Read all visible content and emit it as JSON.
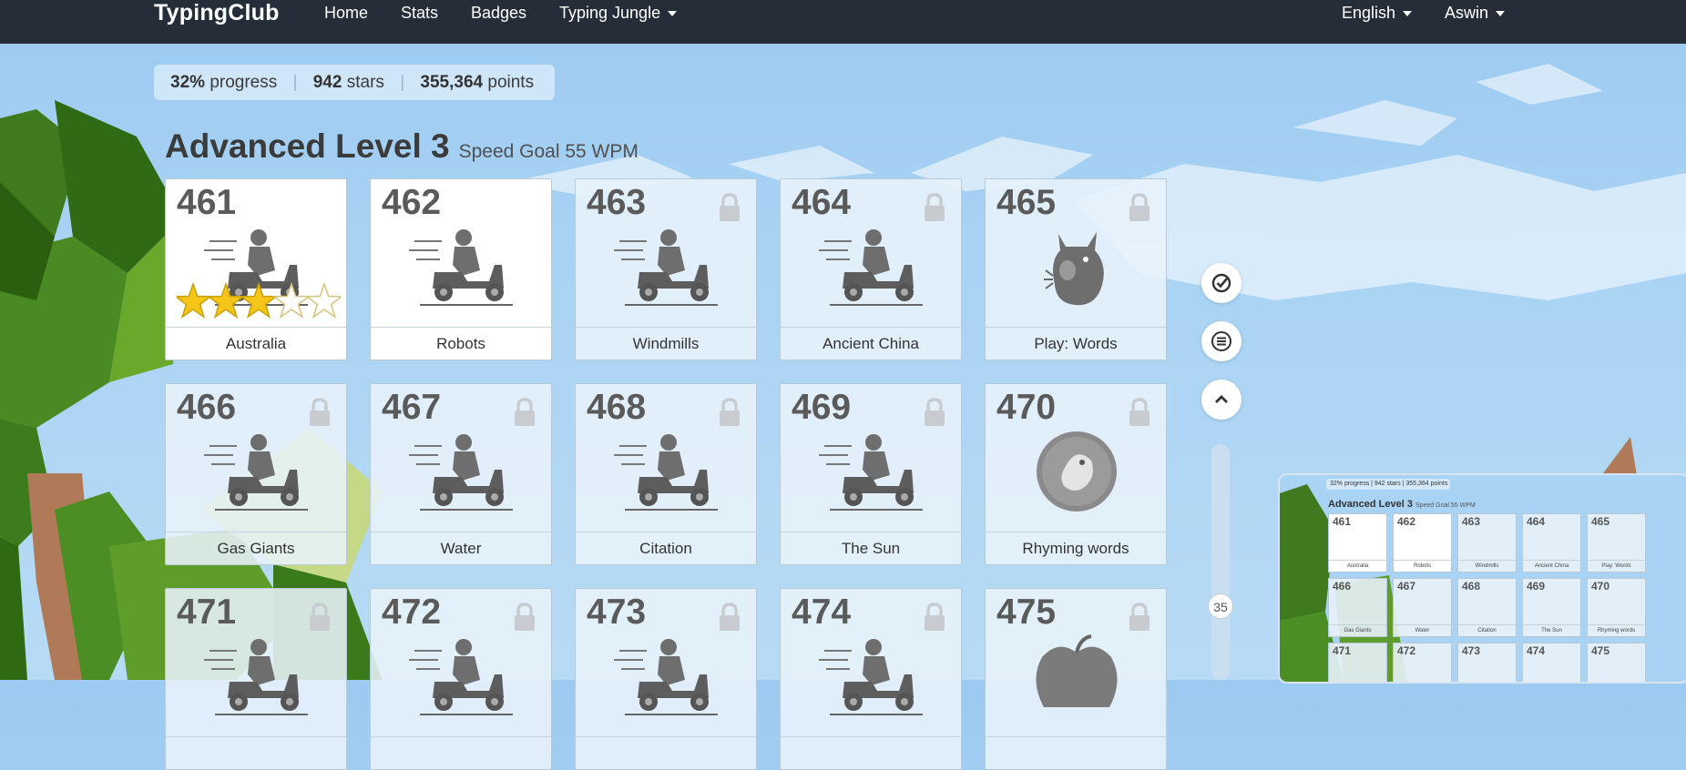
{
  "header": {
    "brand": "TypingClub",
    "nav": {
      "home": "Home",
      "stats": "Stats",
      "badges": "Badges",
      "jungle": "Typing Jungle"
    },
    "language": "English",
    "user": "Aswin"
  },
  "progress": {
    "percent": "32%",
    "percent_label": "progress",
    "stars": "942",
    "stars_label": "stars",
    "points": "355,364",
    "points_label": "points"
  },
  "level": {
    "title": "Advanced Level 3",
    "goal": "Speed Goal 55 WPM"
  },
  "lessons": [
    {
      "num": "461",
      "label": "Australia",
      "locked": false,
      "stars_earned": 3,
      "stars_total": 5,
      "art": "scooter"
    },
    {
      "num": "462",
      "label": "Robots",
      "locked": false,
      "art": "scooter"
    },
    {
      "num": "463",
      "label": "Windmills",
      "locked": true,
      "art": "scooter"
    },
    {
      "num": "464",
      "label": "Ancient China",
      "locked": true,
      "art": "scooter"
    },
    {
      "num": "465",
      "label": "Play: Words",
      "locked": true,
      "art": "monster"
    },
    {
      "num": "466",
      "label": "Gas Giants",
      "locked": true,
      "art": "scooter"
    },
    {
      "num": "467",
      "label": "Water",
      "locked": true,
      "art": "scooter"
    },
    {
      "num": "468",
      "label": "Citation",
      "locked": true,
      "art": "scooter"
    },
    {
      "num": "469",
      "label": "The Sun",
      "locked": true,
      "art": "scooter"
    },
    {
      "num": "470",
      "label": "Rhyming words",
      "locked": true,
      "art": "bird-coin"
    },
    {
      "num": "471",
      "label": "",
      "locked": true,
      "art": "scooter"
    },
    {
      "num": "472",
      "label": "",
      "locked": true,
      "art": "scooter"
    },
    {
      "num": "473",
      "label": "",
      "locked": true,
      "art": "scooter"
    },
    {
      "num": "474",
      "label": "",
      "locked": true,
      "art": "scooter"
    },
    {
      "num": "475",
      "label": "",
      "locked": true,
      "art": "apple"
    }
  ],
  "scroll": {
    "value": "35"
  },
  "thumbnail": {
    "progress_text": "32% progress | 942 stars | 355,364 points",
    "title": "Advanced Level 3",
    "goal": "Speed Goal 55 WPM"
  },
  "icons": {
    "check": "check-circle-icon",
    "menu": "menu-lines-icon",
    "up": "chevron-up-icon",
    "lock": "lock-icon"
  }
}
